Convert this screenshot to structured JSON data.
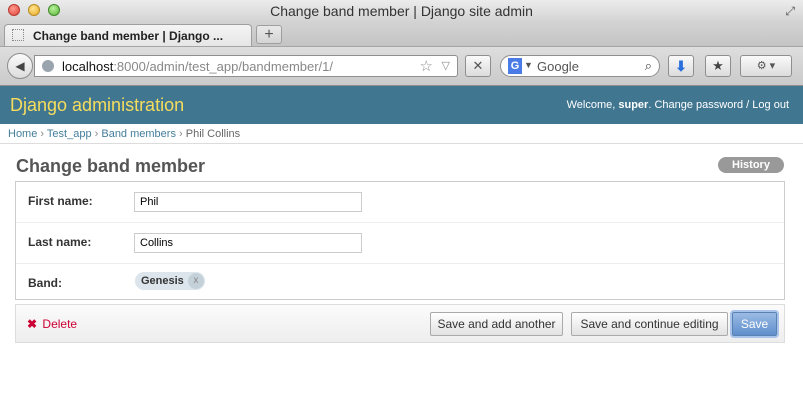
{
  "window": {
    "title": "Change band member | Django site admin",
    "tab_title": "Change band member | Django ...",
    "new_tab_label": "+"
  },
  "navigation": {
    "url_host": "localhost",
    "url_rest": ":8000/admin/test_app/bandmember/1/",
    "search_engine_icon": "G",
    "search_placeholder": "Google"
  },
  "admin": {
    "branding": "Django administration",
    "welcome_prefix": "Welcome, ",
    "username": "super",
    "welcome_suffix": ". ",
    "change_password": "Change password",
    "divider": " / ",
    "logout": "Log out"
  },
  "breadcrumbs": {
    "home": "Home",
    "app": "Test_app",
    "model": "Band members",
    "current": "Phil Collins",
    "separator": " › "
  },
  "page": {
    "title": "Change band member",
    "history_label": "History"
  },
  "form": {
    "first_name_label": "First name:",
    "first_name_value": "Phil",
    "last_name_label": "Last name:",
    "last_name_value": "Collins",
    "band_label": "Band:",
    "band_value": "Genesis",
    "band_remove": "x"
  },
  "actions": {
    "delete_icon": "✖",
    "delete_label": "Delete",
    "save_add_another": "Save and add another",
    "save_continue": "Save and continue editing",
    "save": "Save"
  },
  "colors": {
    "header_bg": "#417690",
    "branding": "#f5dd5d",
    "link": "#447e9b",
    "delete": "#cc0033"
  }
}
